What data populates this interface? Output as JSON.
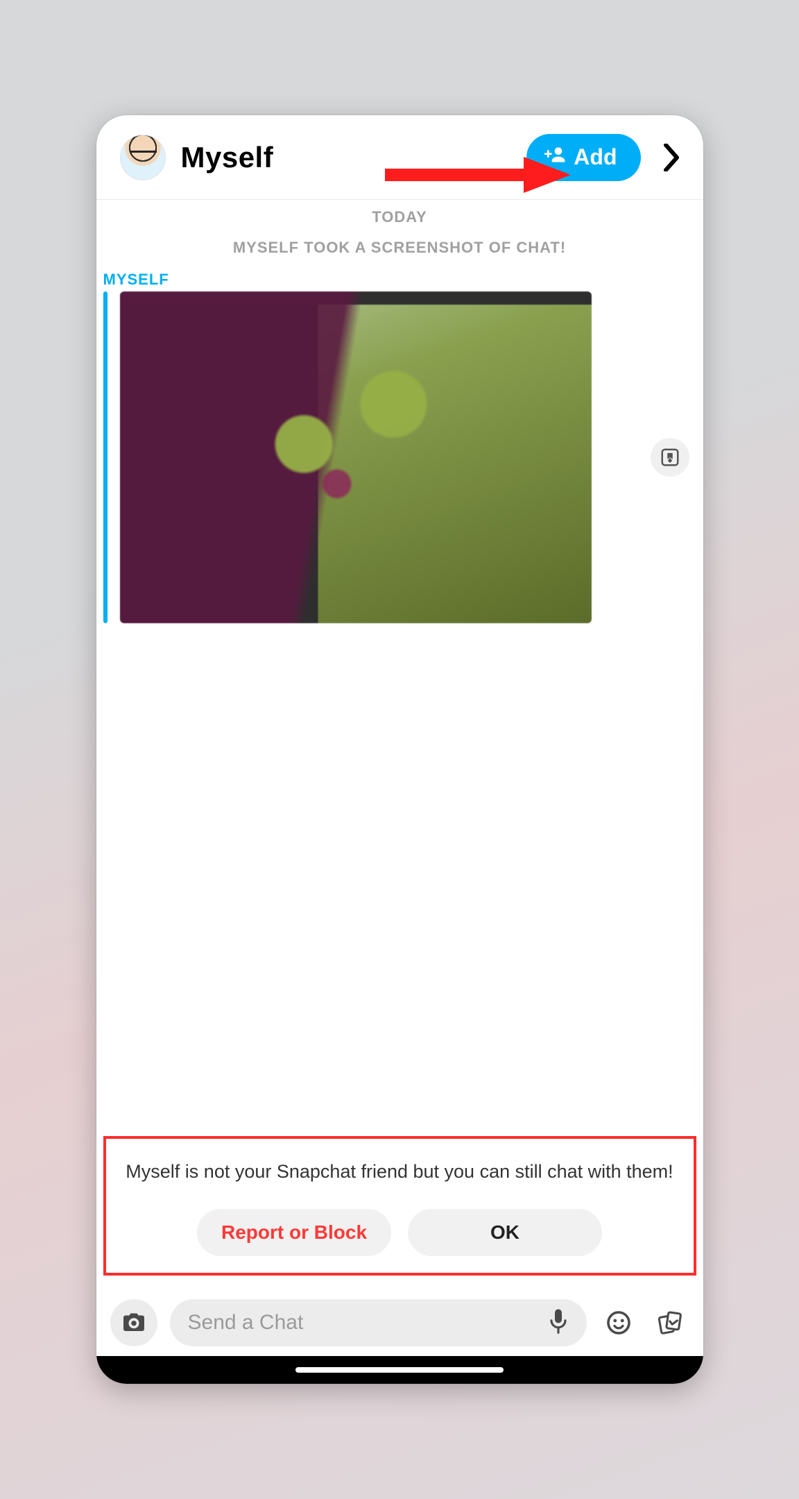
{
  "header": {
    "username": "Myself",
    "add_label": "Add"
  },
  "meta": {
    "today": "TODAY",
    "screenshot": "MYSELF TOOK A SCREENSHOT OF CHAT!"
  },
  "message": {
    "sender": "MYSELF"
  },
  "notice": {
    "text": "Myself is not your Snapchat friend but you can still chat with them!",
    "report_label": "Report or Block",
    "ok_label": "OK"
  },
  "input": {
    "placeholder": "Send a Chat"
  },
  "colors": {
    "accent": "#00aef8",
    "danger": "#ff3936"
  }
}
